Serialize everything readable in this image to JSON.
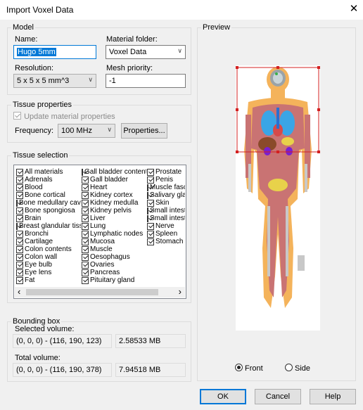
{
  "window": {
    "title": "Import Voxel Data",
    "close_glyph": "✕"
  },
  "model": {
    "group_label": "Model",
    "name_label": "Name:",
    "name_value": "Hugo 5mm",
    "material_folder_label": "Material folder:",
    "material_folder_value": "Voxel Data",
    "resolution_label": "Resolution:",
    "resolution_value": "5 x 5 x 5 mm^3",
    "mesh_priority_label": "Mesh priority:",
    "mesh_priority_value": "-1"
  },
  "tissue_properties": {
    "group_label": "Tissue properties",
    "update_label": "Update material properties",
    "update_checked": true,
    "frequency_label": "Frequency:",
    "frequency_value": "100 MHz",
    "properties_button": "Properties..."
  },
  "tissue_selection": {
    "group_label": "Tissue selection",
    "col1": [
      "All materials",
      "Adrenals",
      "Blood",
      "Bone cortical",
      "Bone medullary cavity",
      "Bone spongiosa",
      "Brain",
      "Breast glandular tissue",
      "Bronchi",
      "Cartilage",
      "Colon contents",
      "Colon wall",
      "Eye bulb",
      "Eye lens",
      "Fat"
    ],
    "col2": [
      "Gall bladder content",
      "Gall bladder",
      "Heart",
      "Kidney cortex",
      "Kidney medulla",
      "Kidney pelvis",
      "Liver",
      "Lung",
      "Lymphatic nodes",
      "Mucosa",
      "Muscle",
      "Oesophagus",
      "Ovaries",
      "Pancreas",
      "Pituitary gland"
    ],
    "col3": [
      "Prostate",
      "Penis",
      "Muscle fascia",
      "Salivary gland",
      "Skin",
      "Small intestine",
      "Small intestine",
      "Nerve",
      "Spleen",
      "Stomach"
    ],
    "scroll_left": "‹",
    "scroll_right": "›"
  },
  "bounding_box": {
    "group_label": "Bounding box",
    "selected_label": "Selected volume:",
    "selected_range": "(0, 0, 0) - (116, 190, 123)",
    "selected_size": "2.58533 MB",
    "total_label": "Total volume:",
    "total_range": "(0, 0, 0) - (116, 190, 378)",
    "total_size": "7.94518 MB"
  },
  "preview": {
    "group_label": "Preview",
    "front_label": "Front",
    "side_label": "Side",
    "selected_view": "Front"
  },
  "buttons": {
    "ok": "OK",
    "cancel": "Cancel",
    "help": "Help"
  }
}
